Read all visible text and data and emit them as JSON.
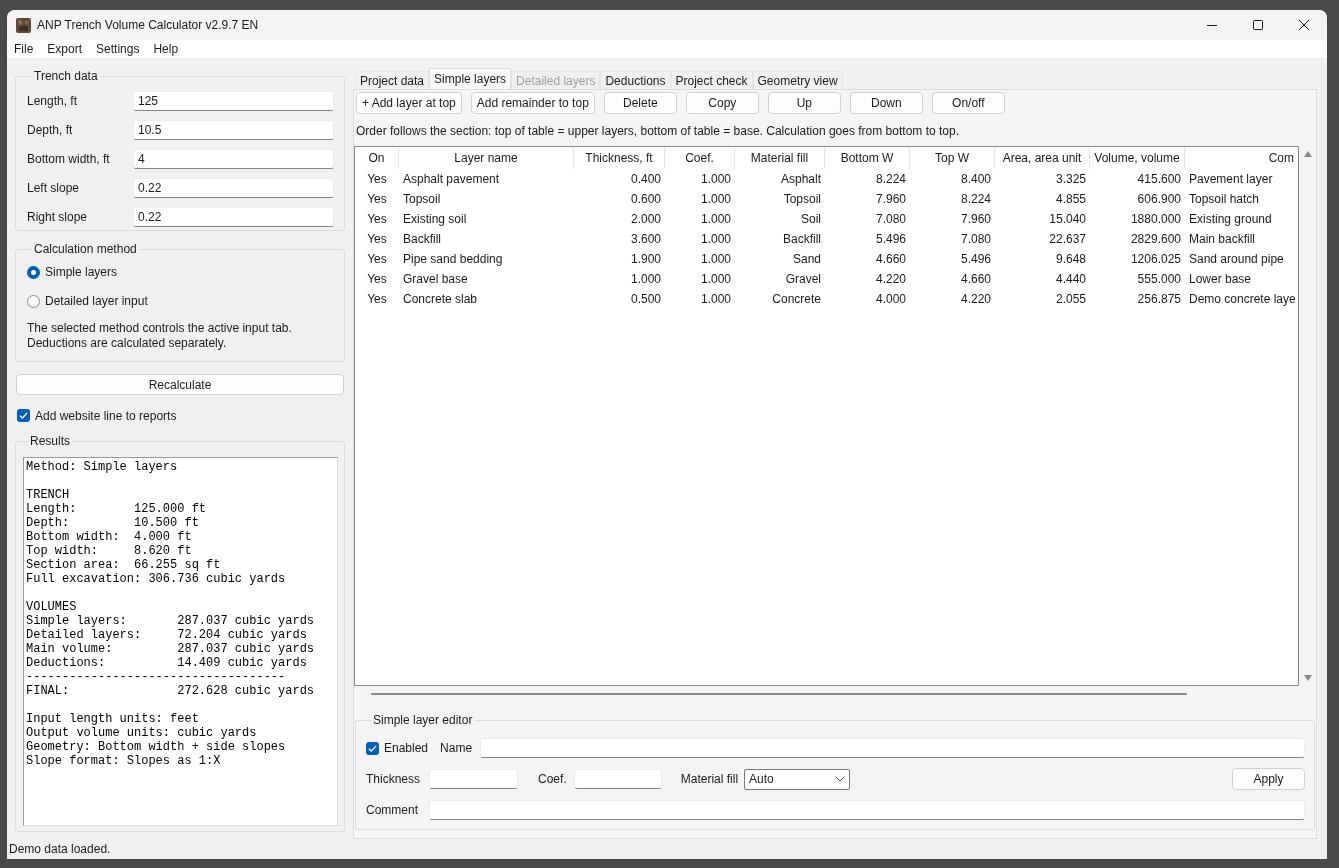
{
  "window": {
    "title": "ANP Trench Volume Calculator v2.9.7 EN"
  },
  "menu": [
    "File",
    "Export",
    "Settings",
    "Help"
  ],
  "trench_data": {
    "title": "Trench data",
    "fields": [
      {
        "label": "Length, ft",
        "value": "125"
      },
      {
        "label": "Depth, ft",
        "value": "10.5"
      },
      {
        "label": "Bottom width, ft",
        "value": "4"
      },
      {
        "label": "Left slope",
        "value": "0.22"
      },
      {
        "label": "Right slope",
        "value": "0.22"
      }
    ]
  },
  "calculation_method": {
    "title": "Calculation method",
    "options": [
      {
        "label": "Simple layers",
        "selected": true
      },
      {
        "label": "Detailed layer input",
        "selected": false
      }
    ],
    "note": "The selected method controls the active input tab.\nDeductions are calculated separately."
  },
  "recalculate_button": "Recalculate",
  "website_line": {
    "label": "Add website line to reports",
    "checked": true
  },
  "results": {
    "title": "Results",
    "text": "Method: Simple layers\n\nTRENCH\nLength:        125.000 ft\nDepth:         10.500 ft\nBottom width:  4.000 ft\nTop width:     8.620 ft\nSection area:  66.255 sq ft\nFull excavation: 306.736 cubic yards\n\nVOLUMES\nSimple layers:       287.037 cubic yards\nDetailed layers:     72.204 cubic yards\nMain volume:         287.037 cubic yards\nDeductions:          14.409 cubic yards\n------------------------------------\nFINAL:               272.628 cubic yards\n\nInput length units: feet\nOutput volume units: cubic yards\nGeometry: Bottom width + side slopes\nSlope format: Slopes as 1:X"
  },
  "tabs": [
    {
      "label": "Project data",
      "selected": false,
      "disabled": false
    },
    {
      "label": "Simple layers",
      "selected": true,
      "disabled": false
    },
    {
      "label": "Detailed layers",
      "selected": false,
      "disabled": true
    },
    {
      "label": "Deductions",
      "selected": false,
      "disabled": false
    },
    {
      "label": "Project check",
      "selected": false,
      "disabled": false
    },
    {
      "label": "Geometry view",
      "selected": false,
      "disabled": false
    }
  ],
  "toolbar": [
    "+ Add layer at top",
    "Add remainder to top",
    "Delete",
    "Copy",
    "Up",
    "Down",
    "On/off"
  ],
  "info": "Order follows the section: top of table = upper layers, bottom of table = base. Calculation goes from bottom to top.",
  "table": {
    "columns": [
      "On",
      "Layer name",
      "Thickness, ft",
      "Coef.",
      "Material fill",
      "Bottom W",
      "Top W",
      "Area, area unit",
      "Volume, volume",
      "Com"
    ],
    "rows": [
      [
        "Yes",
        "Asphalt pavement",
        "0.400",
        "1.000",
        "Asphalt",
        "8.224",
        "8.400",
        "3.325",
        "415.600",
        "Pavement layer"
      ],
      [
        "Yes",
        "Topsoil",
        "0.600",
        "1.000",
        "Topsoil",
        "7.960",
        "8.224",
        "4.855",
        "606.900",
        "Topsoil hatch"
      ],
      [
        "Yes",
        "Existing soil",
        "2.000",
        "1.000",
        "Soil",
        "7.080",
        "7.960",
        "15.040",
        "1880.000",
        "Existing ground"
      ],
      [
        "Yes",
        "Backfill",
        "3.600",
        "1.000",
        "Backfill",
        "5.496",
        "7.080",
        "22.637",
        "2829.600",
        "Main backfill"
      ],
      [
        "Yes",
        "Pipe sand bedding",
        "1.900",
        "1.000",
        "Sand",
        "4.660",
        "5.496",
        "9.648",
        "1206.025",
        "Sand around pipe"
      ],
      [
        "Yes",
        "Gravel base",
        "1.000",
        "1.000",
        "Gravel",
        "4.220",
        "4.660",
        "4.440",
        "555.000",
        "Lower base"
      ],
      [
        "Yes",
        "Concrete slab",
        "0.500",
        "1.000",
        "Concrete",
        "4.000",
        "4.220",
        "2.055",
        "256.875",
        "Demo concrete laye"
      ]
    ]
  },
  "editor": {
    "title": "Simple layer editor",
    "enabled": {
      "label": "Enabled",
      "checked": true
    },
    "name_label": "Name",
    "thickness_label": "Thickness",
    "coef_label": "Coef.",
    "material_fill": {
      "label": "Material fill",
      "value": "Auto"
    },
    "apply_button": "Apply",
    "comment_label": "Comment"
  },
  "status_bar": "Demo data loaded."
}
